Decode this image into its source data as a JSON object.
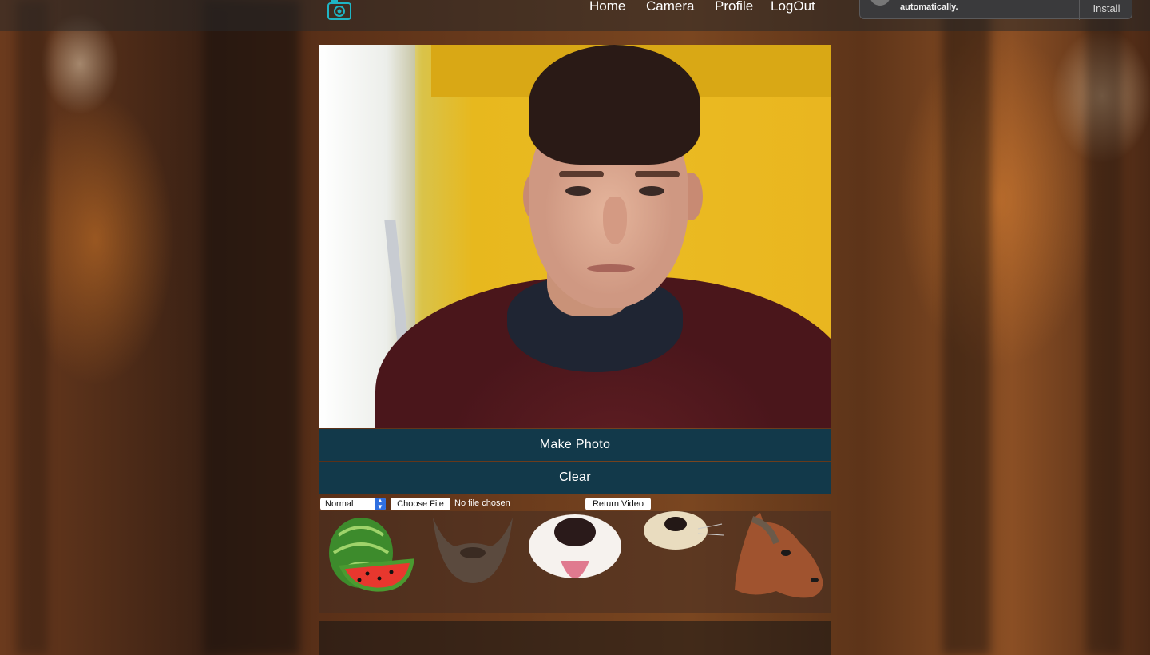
{
  "nav": {
    "logo_icon": "camera-icon",
    "links": [
      "Home",
      "Camera",
      "Profile",
      "LogOut"
    ]
  },
  "install_prompt": {
    "text": "automatically.",
    "button": "Install"
  },
  "actions": {
    "make_photo": "Make Photo",
    "clear": "Clear"
  },
  "controls": {
    "filter_selected": "Normal",
    "choose_file": "Choose File",
    "file_status": "No file chosen",
    "return_video": "Return Video"
  },
  "masks": [
    "watermelon",
    "beard",
    "dog-snout",
    "puppy-nose",
    "horse-head"
  ],
  "colors": {
    "accent": "#12394a",
    "logo": "#1fb5c4"
  }
}
